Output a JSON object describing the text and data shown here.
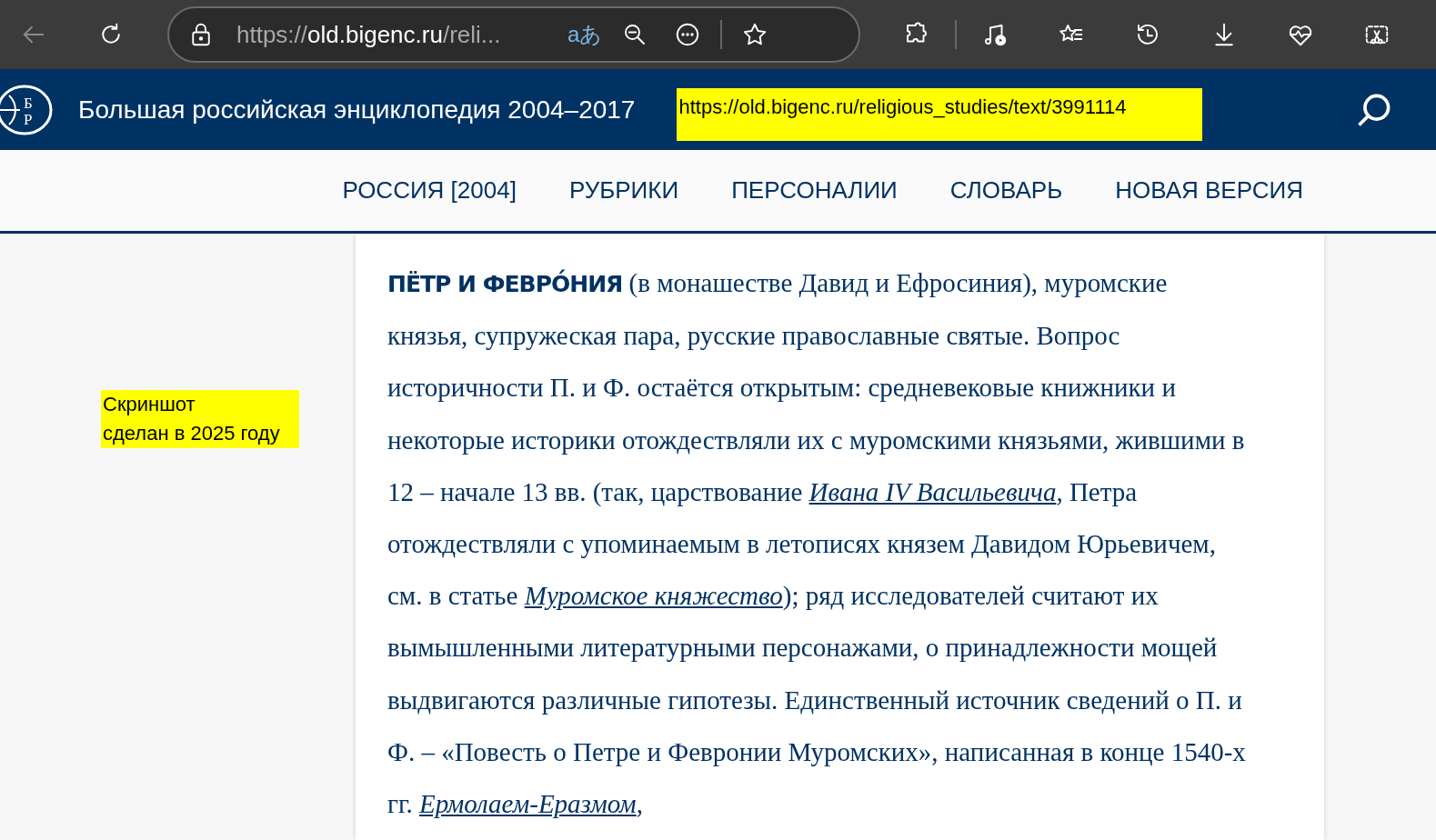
{
  "browser": {
    "url": {
      "scheme": "https://",
      "host": "old.bigenc.ru",
      "path": "/reli..."
    },
    "translate_glyph": "aあ"
  },
  "site_header": {
    "logo_letters": [
      "Б",
      "Р"
    ],
    "title": "Большая российская энциклопедия 2004–2017",
    "highlight_url": "https://old.bigenc.ru/religious_studies/text/3991114"
  },
  "nav": [
    {
      "label": "РОССИЯ [2004]"
    },
    {
      "label": "РУБРИКИ"
    },
    {
      "label": "ПЕРСОНАЛИИ"
    },
    {
      "label": "СЛОВАРЬ"
    },
    {
      "label": "НОВАЯ ВЕРСИЯ"
    }
  ],
  "note": {
    "lines": [
      "Скриншот",
      "сделан в 2025 году"
    ]
  },
  "article": {
    "segments": [
      {
        "kind": "headword",
        "text": "ПЁТР И ФЕВРО́НИЯ"
      },
      {
        "kind": "text",
        "text": " (в монашестве Давид и Ефросиния), муромские князья, супружеская пара, русские православные святые. Вопрос историчности П. и Ф. остаётся открытым: средневековые книжники и некоторые историки отождествляли их с муромскими князьями, жившими в 12 – начале 13 вв. (так, царствование "
      },
      {
        "kind": "link",
        "text": "Ивана IV Васильевича"
      },
      {
        "kind": "text",
        "text": ", Петра отождествляли с упоминаемым в летописях князем Давидом Юрьевичем, см. в статье "
      },
      {
        "kind": "link",
        "text": "Муромское княжество"
      },
      {
        "kind": "text",
        "text": "); ряд исследователей считают их вымышленными литературными персонажами, о принадлежности мощей выдвигаются различные гипотезы. Единственный источник сведений о П. и Ф. – «Повесть о Петре и Февронии Муромских», написанная в конце 1540-х гг. "
      },
      {
        "kind": "link",
        "text": "Ермолаем-Еразмом"
      },
      {
        "kind": "text",
        "text": ","
      }
    ]
  }
}
